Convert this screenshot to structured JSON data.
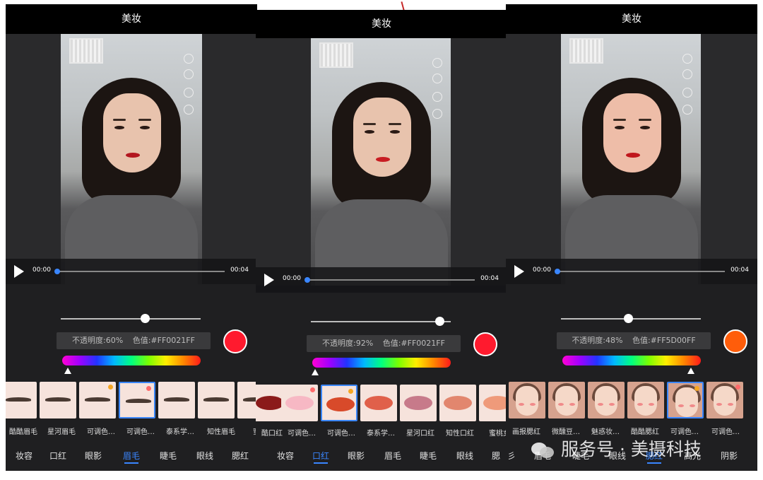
{
  "panels": [
    {
      "title": "美妆",
      "time_start": "00:00",
      "time_end": "00:04",
      "opacity_label": "不透明度:60%",
      "color_label": "色值:#FF0021FF",
      "swatch_color": "#ff1a2e",
      "opacity": 0.6,
      "hue_pointer": 0.04,
      "items": [
        {
          "label": "酷酷眉毛",
          "kind": "brow",
          "selected": false,
          "dot": ""
        },
        {
          "label": "星河眉毛",
          "kind": "brow",
          "selected": false,
          "dot": ""
        },
        {
          "label": "可调色…",
          "kind": "brow",
          "selected": false,
          "dot": "#f5a623"
        },
        {
          "label": "可调色…",
          "kind": "brow",
          "selected": true,
          "dot": "#ff6b6b"
        },
        {
          "label": "泰系学…",
          "kind": "brow",
          "selected": false,
          "dot": ""
        },
        {
          "label": "知性眉毛",
          "kind": "brow",
          "selected": false,
          "dot": ""
        },
        {
          "label": "蜜",
          "kind": "brow",
          "selected": false,
          "dot": ""
        }
      ],
      "tabs": [
        "妆容",
        "口红",
        "眼影",
        "眉毛",
        "睫毛",
        "眼线",
        "腮红"
      ],
      "active_tab": 3
    },
    {
      "title": "美妆",
      "time_start": "00:00",
      "time_end": "00:04",
      "opacity_label": "不透明度:92%",
      "color_label": "色值:#FF0021FF",
      "swatch_color": "#ff1a2e",
      "opacity": 0.92,
      "hue_pointer": 0.02,
      "items": [
        {
          "label": "酷口红",
          "kind": "lip",
          "color": "#8b1a1a",
          "selected": false,
          "dot": ""
        },
        {
          "label": "可调色…",
          "kind": "lip",
          "color": "#f7b8c4",
          "selected": false,
          "dot": "#ff6b6b"
        },
        {
          "label": "可调色…",
          "kind": "lip",
          "color": "#d84a2a",
          "selected": true,
          "dot": "#f5a623"
        },
        {
          "label": "泰系学…",
          "kind": "lip",
          "color": "#e0604a",
          "selected": false,
          "dot": ""
        },
        {
          "label": "星河口红",
          "kind": "lip",
          "color": "#c77a8a",
          "selected": false,
          "dot": ""
        },
        {
          "label": "知性口红",
          "kind": "lip",
          "color": "#e2866e",
          "selected": false,
          "dot": ""
        },
        {
          "label": "蜜桃女",
          "kind": "lip",
          "color": "#ef9a7a",
          "selected": false,
          "dot": ""
        }
      ],
      "tabs": [
        "妆容",
        "口红",
        "眼影",
        "眉毛",
        "睫毛",
        "眼线",
        "腮"
      ],
      "active_tab": 1
    },
    {
      "title": "美妆",
      "time_start": "00:00",
      "time_end": "00:04",
      "opacity_label": "不透明度:48%",
      "color_label": "色值:#FF5D00FF",
      "swatch_color": "#ff5d0a",
      "opacity": 0.48,
      "hue_pointer": 0.93,
      "items": [
        {
          "label": "画报腮红",
          "kind": "face",
          "selected": false,
          "dot": ""
        },
        {
          "label": "微醺豆…",
          "kind": "face",
          "selected": false,
          "dot": ""
        },
        {
          "label": "魅惑妆…",
          "kind": "face",
          "selected": false,
          "dot": ""
        },
        {
          "label": "酷酷腮红",
          "kind": "face",
          "selected": false,
          "dot": ""
        },
        {
          "label": "可调色…",
          "kind": "face",
          "selected": true,
          "dot": "#f5a623"
        },
        {
          "label": "可调色…",
          "kind": "face",
          "selected": false,
          "dot": "#ff6b6b"
        }
      ],
      "tabs": [
        "彡",
        "眉毛",
        "睫毛",
        "眼线",
        "腮红",
        "高光",
        "阴影"
      ],
      "active_tab": 4
    }
  ],
  "watermark": "服务号 · 美摄科技"
}
